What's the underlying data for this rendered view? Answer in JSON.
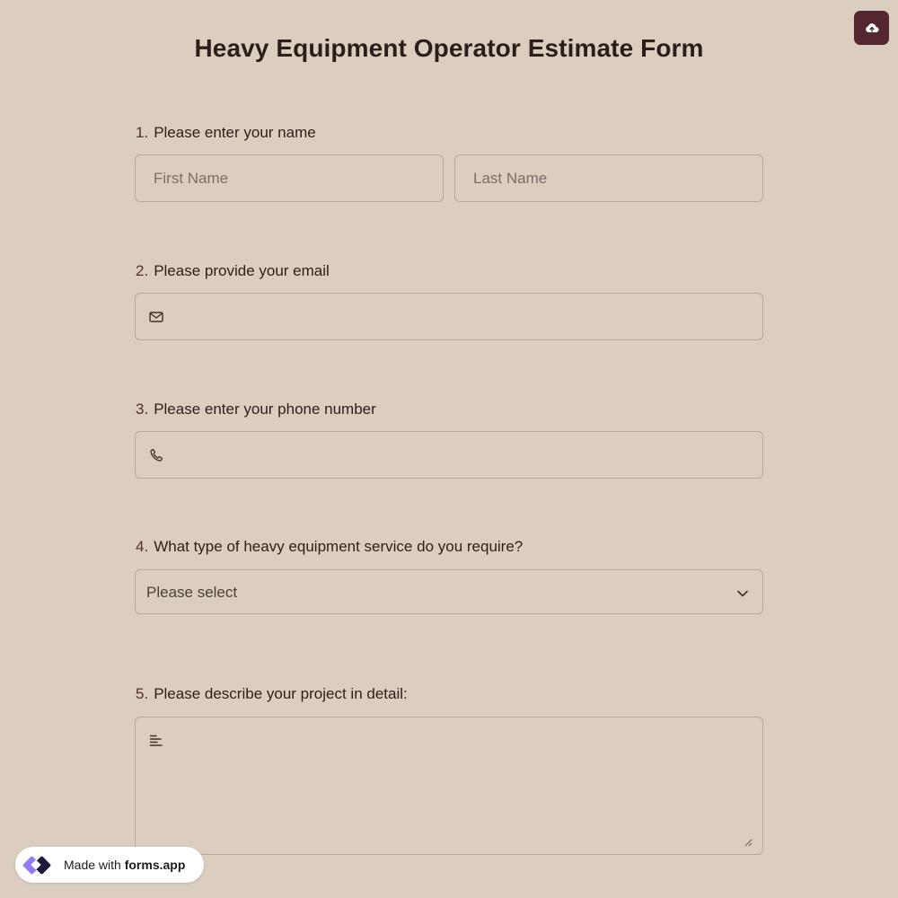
{
  "form": {
    "title": "Heavy Equipment Operator Estimate Form"
  },
  "questions": [
    {
      "number": "1.",
      "label": "Please enter your name",
      "fields": [
        {
          "placeholder": "First Name"
        },
        {
          "placeholder": "Last Name"
        }
      ]
    },
    {
      "number": "2.",
      "label": "Please provide your email",
      "icon": "mail-icon"
    },
    {
      "number": "3.",
      "label": "Please enter your phone number",
      "icon": "phone-icon"
    },
    {
      "number": "4.",
      "label": "What type of heavy equipment service do you require?",
      "select_value": "Please select",
      "icon": "chevron-down-icon"
    },
    {
      "number": "5.",
      "label": "Please describe your project in detail:",
      "icon": "text-align-icon"
    }
  ],
  "toolbar": {
    "save_icon": "cloud-upload-icon"
  },
  "branding": {
    "prefix": "Made with",
    "name": "forms.app"
  },
  "colors": {
    "background": "#dbcebf",
    "accent": "#54262f",
    "number": "#5a2a33",
    "border": "#b7aa9c"
  }
}
